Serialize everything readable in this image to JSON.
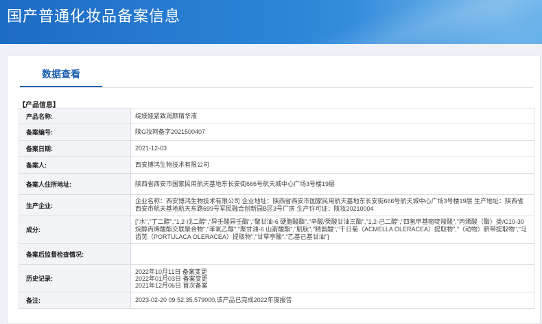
{
  "header": {
    "title": "国产普通化妆品备案信息"
  },
  "tabs": [
    {
      "label": "数据查看"
    }
  ],
  "section": {
    "label": "【产品信息】"
  },
  "rows": {
    "product_name": {
      "key": "产品名称:",
      "value": "绽媄娅紧致润颜精华液"
    },
    "record_no": {
      "key": "备案编号:",
      "value": "陕G妆网备字2021500407"
    },
    "record_date": {
      "key": "备案日期:",
      "value": "2021-12-03"
    },
    "registrant": {
      "key": "备案人:",
      "value": "西安博鸿生物技术有限公司"
    },
    "registrant_address": {
      "key": "备案人住所地址:",
      "value": "陕西省西安市国家民用航天基地东长安街666号航天城中心广场3号楼19层"
    },
    "manufacturer": {
      "key": "生产企业:",
      "value": "企业名称：西安博鸿生物技术有限公司 企业地址：陕西省西安市国家民用航天基地东长安街666号航天城中心广场3号楼19层 生产地址：陕西省西安市航天基地航天东路699号军民融合创新园B区3号厂房 生产许可证：陕妆20210004"
    },
    "ingredients": {
      "key": "成分:",
      "value": "[\"水\",\"丁二醇\",\"1,2-戊二醇\",\"异壬酸异壬酯\",\"聚甘油-6 硬脂酸酯\",\"辛酸/癸酸甘油三酯\",\"1,2-己二醇\",\"四氢甲基嘧啶羧酸\",\"丙烯酸（酯）类/C10-30 烷醇丙烯酸酯交联聚合物\",\"苯氧乙醇\",\"聚甘油-6 山嵛酸酯\",\"肌肽\",\"精氨酸\",\"千日菊（ACMELLA OLERACEA）提取物\",\"（动物）脐带提取物\",\"马齿苋（PORTULACA OLERACEA）提取物\",\"甘草亭酸\",\"乙基己基甘油\"]"
    },
    "supervision": {
      "key": "备案后监督检查情况:",
      "value": ""
    },
    "history": {
      "key": "历史记录:",
      "items": [
        "2022年10月11日 备案变更",
        "2022年01月03日 备案变更",
        "2021年12月06日 首次备案"
      ]
    },
    "remark": {
      "key": "备注:",
      "value": "2023-02-20 09:52:35.579000,该产品已完成2022年度报告"
    }
  }
}
